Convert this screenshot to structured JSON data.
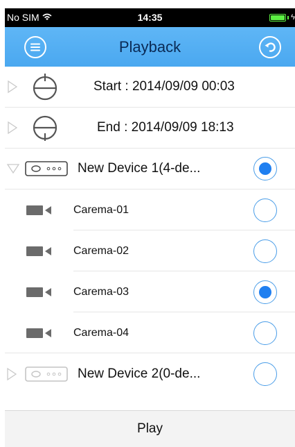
{
  "status_bar": {
    "carrier": "No SIM",
    "time": "14:35"
  },
  "nav": {
    "title": "Playback",
    "menu_icon": "menu-icon",
    "back_icon": "undo-icon"
  },
  "times": {
    "start": "Start : 2014/09/09 00:03",
    "end": "End : 2014/09/09 18:13"
  },
  "devices": [
    {
      "name": "New Device 1(4-de...",
      "expanded": true,
      "selected": true,
      "cameras": [
        {
          "name": "Carema-01",
          "selected": false
        },
        {
          "name": "Carema-02",
          "selected": false
        },
        {
          "name": "Carema-03",
          "selected": true
        },
        {
          "name": "Carema-04",
          "selected": false
        }
      ]
    },
    {
      "name": "New Device 2(0-de...",
      "expanded": false,
      "selected": false,
      "cameras": []
    }
  ],
  "play_label": "Play",
  "colors": {
    "nav_blue": "#4aa8f0",
    "radio_blue": "#1f7ff0",
    "battery_green": "#5cf043"
  }
}
